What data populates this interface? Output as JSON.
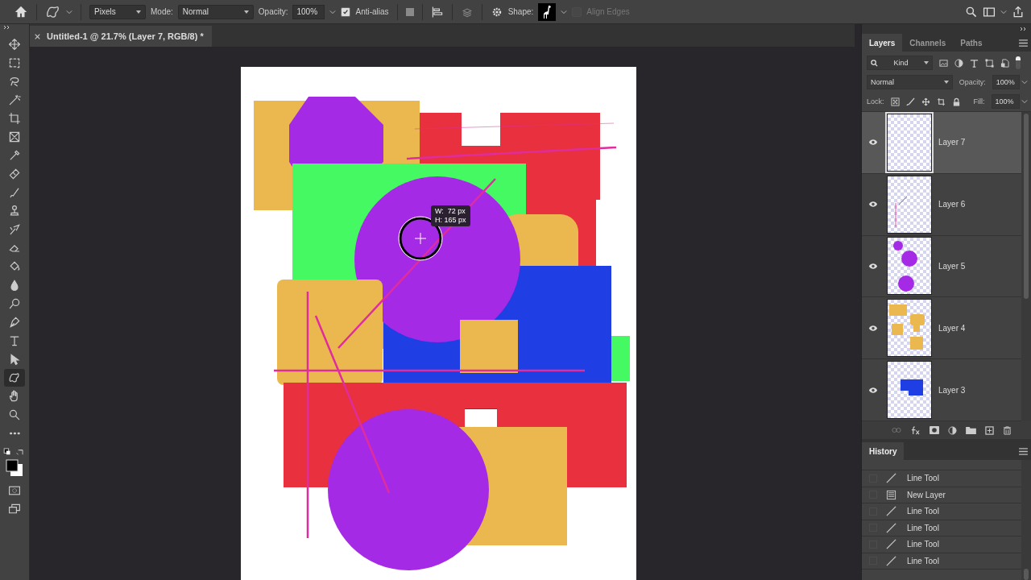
{
  "options_bar": {
    "preset": "Pixels",
    "mode_label": "Mode:",
    "mode": "Normal",
    "opacity_label": "Opacity:",
    "opacity": "100%",
    "anti_alias": {
      "label": "Anti-alias",
      "checked": true
    },
    "shape_label": "Shape:",
    "align_edges": {
      "label": "Align Edges",
      "checked": false,
      "disabled": true
    }
  },
  "document_tab": {
    "title": "Untitled-1 @ 21.7% (Layer 7, RGB/8) *"
  },
  "tools": [
    {
      "kind": "move",
      "selected": false
    },
    {
      "kind": "marquee",
      "selected": false
    },
    {
      "kind": "lasso",
      "selected": false
    },
    {
      "kind": "wand",
      "selected": false
    },
    {
      "kind": "crop",
      "selected": false
    },
    {
      "kind": "frame",
      "selected": false
    },
    {
      "kind": "eyedropper",
      "selected": false
    },
    {
      "kind": "bandage",
      "selected": false
    },
    {
      "kind": "brush",
      "selected": false
    },
    {
      "kind": "stamp",
      "selected": false
    },
    {
      "kind": "history",
      "selected": false
    },
    {
      "kind": "eraser",
      "selected": false
    },
    {
      "kind": "bucket",
      "selected": false
    },
    {
      "kind": "drop",
      "selected": false
    },
    {
      "kind": "dodge",
      "selected": false
    },
    {
      "kind": "pen",
      "selected": false
    },
    {
      "kind": "type",
      "selected": false
    },
    {
      "kind": "arrow",
      "selected": false
    },
    {
      "kind": "shape",
      "selected": true
    },
    {
      "kind": "hand",
      "selected": false
    },
    {
      "kind": "zoom",
      "selected": false
    },
    {
      "kind": "more",
      "selected": false
    }
  ],
  "canvas": {
    "tooltip": [
      "W:  72 px",
      "H: 165 px"
    ]
  },
  "layers_panel": {
    "tabs": [
      {
        "label": "Layers",
        "selected": true
      },
      {
        "label": "Channels",
        "selected": false
      },
      {
        "label": "Paths",
        "selected": false
      }
    ],
    "filter": "Kind",
    "blend_mode": "Normal",
    "opacity_label": "Opacity:",
    "opacity": "100%",
    "lock_label": "Lock:",
    "fill_label": "Fill:",
    "fill": "100%",
    "layers": [
      {
        "name": "Layer 7",
        "visible": true,
        "selected": true,
        "kind": "empty"
      },
      {
        "name": "Layer 6",
        "visible": true,
        "selected": false,
        "kind": "lines"
      },
      {
        "name": "Layer 5",
        "visible": true,
        "selected": false,
        "kind": "circles"
      },
      {
        "name": "Layer 4",
        "visible": true,
        "selected": false,
        "kind": "orange-shapes"
      },
      {
        "name": "Layer 3",
        "visible": true,
        "selected": false,
        "kind": "blue-shapes"
      }
    ]
  },
  "history_panel": {
    "title": "History",
    "items": [
      {
        "label": "Line Tool",
        "kind": "line"
      },
      {
        "label": "New Layer",
        "kind": "layer"
      },
      {
        "label": "Line Tool",
        "kind": "line"
      },
      {
        "label": "Line Tool",
        "kind": "line"
      },
      {
        "label": "Line Tool",
        "kind": "line"
      },
      {
        "label": "Line Tool",
        "kind": "line"
      }
    ]
  }
}
